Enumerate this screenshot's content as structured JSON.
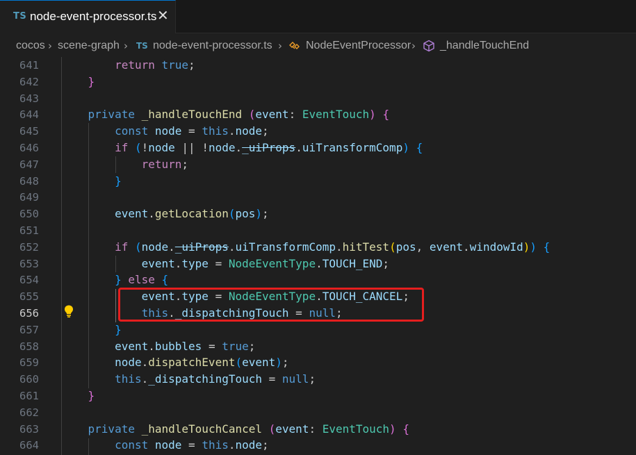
{
  "tab": {
    "lang_badge": "TS",
    "filename": "node-event-processor.ts",
    "close_glyph": "✕"
  },
  "breadcrumb": {
    "items": [
      "cocos",
      "scene-graph",
      "node-event-processor.ts",
      "NodeEventProcessor",
      "_handleTouchEnd"
    ],
    "file_badge": "TS"
  },
  "code": {
    "active_line": 656,
    "line_numbers": [
      "641",
      "642",
      "643",
      "644",
      "645",
      "646",
      "647",
      "648",
      "649",
      "650",
      "651",
      "652",
      "653",
      "654",
      "655",
      "656",
      "657",
      "658",
      "659",
      "660",
      "661",
      "662",
      "663",
      "664"
    ]
  },
  "colors": {
    "background": "#1f1f1f",
    "keyword": "#569cd6",
    "control": "#c586c0",
    "function": "#dcdcaa",
    "variable": "#9cdcfe",
    "type": "#4ec9b0",
    "highlight_box": "#e51e1e",
    "accent": "#0078d4"
  },
  "icons": {
    "lightbulb": "lightbulb-icon",
    "class": "class-icon",
    "method": "method-icon"
  }
}
